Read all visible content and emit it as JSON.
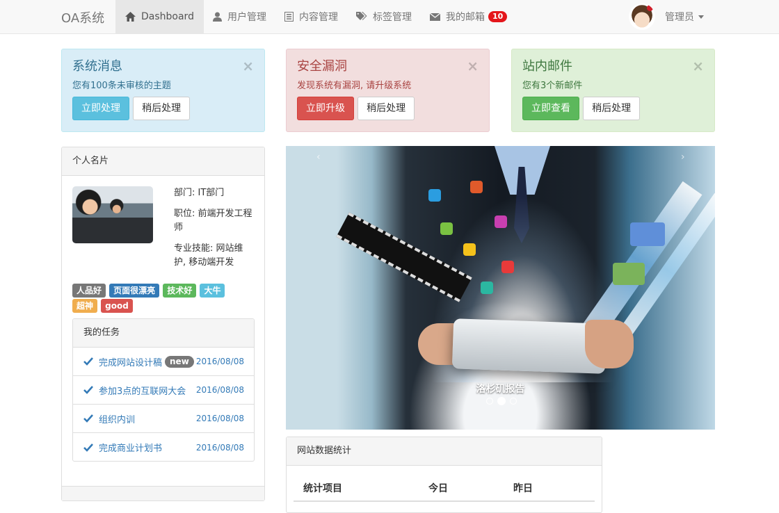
{
  "navbar": {
    "brand": "OA系统",
    "items": [
      {
        "label": "Dashboard",
        "icon": "home-icon",
        "active": true
      },
      {
        "label": "用户管理",
        "icon": "user-icon"
      },
      {
        "label": "内容管理",
        "icon": "list-icon"
      },
      {
        "label": "标签管理",
        "icon": "tags-icon"
      },
      {
        "label": "我的邮箱",
        "icon": "envelope-icon",
        "badge": "10"
      }
    ],
    "user": {
      "name": "管理员"
    }
  },
  "alerts": [
    {
      "title": "系统消息",
      "text": "您有100条未审核的主题",
      "primary": "立即处理",
      "secondary": "稍后处理",
      "close": "×"
    },
    {
      "title": "安全漏洞",
      "text": "发现系统有漏洞, 请升级系统",
      "primary": "立即升级",
      "secondary": "稍后处理",
      "close": "×"
    },
    {
      "title": "站内邮件",
      "text": "您有3个新邮件",
      "primary": "立即查看",
      "secondary": "稍后处理",
      "close": "×"
    }
  ],
  "profile": {
    "heading": "个人名片",
    "department": "部门: IT部门",
    "position": "职位: 前端开发工程师",
    "skills": "专业技能: 网站维护, 移动端开发",
    "tags": [
      "人品好",
      "页面很漂亮",
      "技术好",
      "大牛",
      "超神",
      "good"
    ]
  },
  "tasks": {
    "heading": "我的任务",
    "items": [
      {
        "title": "完成网站设计稿",
        "badge": "new",
        "date": "2016/08/08"
      },
      {
        "title": "参加3点的互联网大会",
        "date": "2016/08/08"
      },
      {
        "title": "组织内训",
        "date": "2016/08/08"
      },
      {
        "title": "完成商业计划书",
        "date": "2016/08/08"
      }
    ]
  },
  "carousel": {
    "caption": "洛杉矶报告",
    "prev": "‹",
    "next": "›",
    "slides": 3,
    "active_slide": 2
  },
  "stats": {
    "heading": "网站数据统计",
    "columns": [
      "统计项目",
      "今日",
      "昨日"
    ]
  },
  "colors": {
    "info": "#d9edf7",
    "danger": "#f2dede",
    "success": "#dff0d8",
    "link": "#337ab7",
    "mail_badge": "#e4161b"
  }
}
